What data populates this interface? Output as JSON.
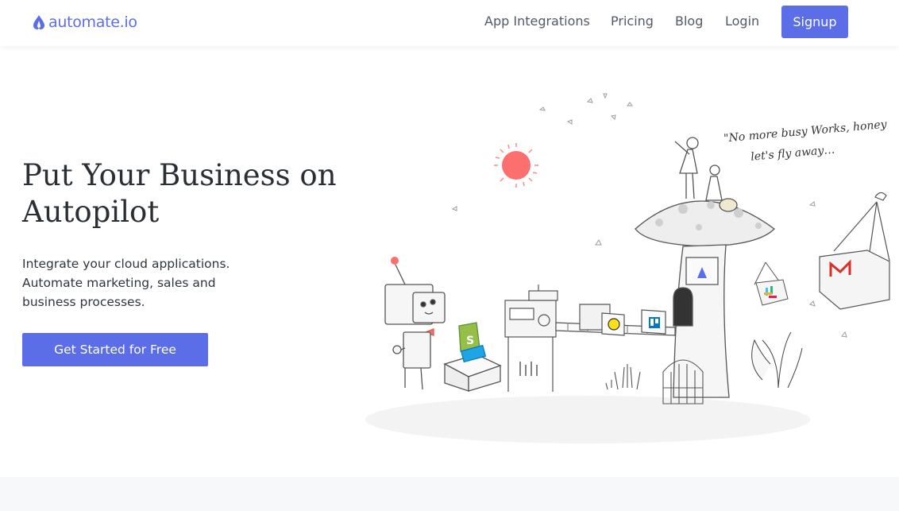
{
  "header": {
    "logo_text": "automate.io",
    "nav": {
      "app_integrations": "App Integrations",
      "pricing": "Pricing",
      "blog": "Blog",
      "login": "Login",
      "signup": "Signup"
    }
  },
  "hero": {
    "title": "Put Your Business on Autopilot",
    "subtitle_lines": [
      "Integrate your cloud applications.",
      "Automate marketing, sales and",
      "business processes."
    ],
    "cta_label": "Get Started for Free",
    "quote_lines": [
      "\"No more busy Works, honey",
      "let's fly away…"
    ]
  },
  "colors": {
    "brand": "#5b6ee8",
    "nav_text": "#525a66",
    "title": "#2a2f36",
    "sun": "#fb6f6f"
  },
  "icons": [
    "automate-logo-icon",
    "robot-illustration",
    "mushroom-house-illustration",
    "gmail-box-icon",
    "shopify-bag-icon",
    "trello-box-icon",
    "mailchimp-box-icon",
    "slack-box-icon",
    "sun-icon",
    "birdcage-icon"
  ]
}
